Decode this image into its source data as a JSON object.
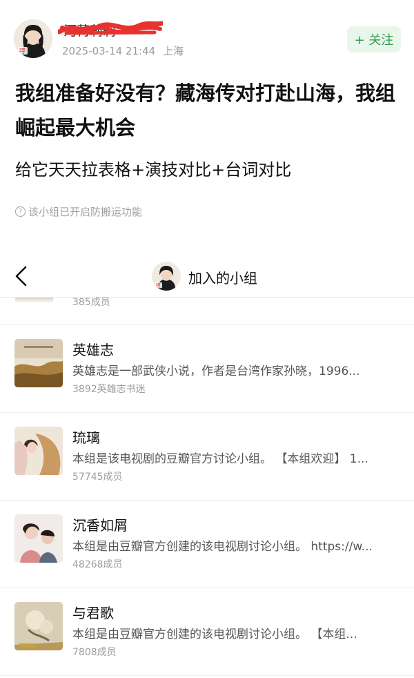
{
  "post": {
    "username": "河荷莉莉",
    "date": "2025-03-14 21:44",
    "location": "上海",
    "follow_label": "+ 关注",
    "title": "我组准备好没有？藏海传对打赴山海，我组崛起最大机会",
    "body": "给它天天拉表格+演技对比+台词对比",
    "notice": "该小组已开启防搬运功能"
  },
  "group_page": {
    "title": "加入的小组",
    "previous_count": "385成员",
    "groups": [
      {
        "name": "英雄志",
        "desc": "英雄志是一部武侠小说，作者是台湾作家孙晓，1996...",
        "count": "3892英雄志书迷"
      },
      {
        "name": "琉璃",
        "desc": "本组是该电视剧的豆瓣官方讨论小组。 【本组欢迎】 1...",
        "count": "57745成员"
      },
      {
        "name": "沉香如屑",
        "desc": "本组是由豆瓣官方创建的该电视剧讨论小组。 https://w...",
        "count": "48268成员"
      },
      {
        "name": "与君歌",
        "desc": "本组是由豆瓣官方创建的该电视剧讨论小组。 【本组...",
        "count": "7808成员"
      }
    ]
  },
  "colors": {
    "follow_green": "#2f9e4d",
    "follow_bg": "#e9f6ec",
    "scribble_red": "#e8322f"
  },
  "icons": [
    "avatar",
    "back-chevron-icon",
    "question-circle-icon"
  ]
}
